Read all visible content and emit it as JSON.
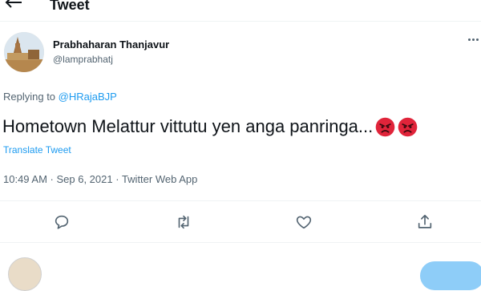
{
  "header": {
    "title": "Tweet",
    "back_icon": "arrow-left-icon"
  },
  "author": {
    "name": "Prabhaharan Thanjavur",
    "handle": "@lamprabhatj"
  },
  "replying": {
    "prefix": "Replying to ",
    "handle": "@HRajaBJP"
  },
  "tweet": {
    "text": "Hometown Melattur vittutu yen anga panringa...",
    "emoji_count": 2,
    "emoji_name": "pouting-face-icon"
  },
  "translate_label": "Translate Tweet",
  "meta": {
    "time_date": "10:49 AM · Sep 6, 2021",
    "source": "Twitter Web App"
  },
  "actions": [
    "reply-icon",
    "retweet-icon",
    "like-icon",
    "share-icon"
  ],
  "colors": {
    "accent": "#1d9bf0",
    "muted": "#536471",
    "text": "#0f1419",
    "emoji_red": "#e0243a"
  }
}
